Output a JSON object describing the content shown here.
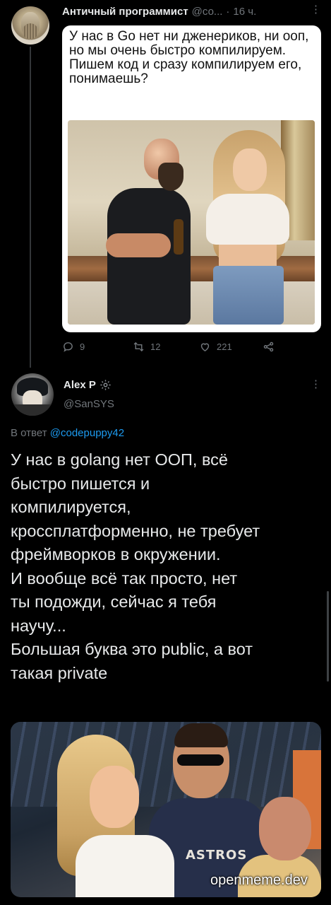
{
  "tweet1": {
    "author_name": "Античный программист",
    "handle_truncated": "@со...",
    "separator": "·",
    "time": "16 ч.",
    "more": "⋮",
    "quote_text": "У нас в Go нет ни дженериков, ни ооп, но мы очень быстро компилируем. Пишем код и сразу компилируем его, понимаешь?",
    "stats": {
      "replies": "9",
      "retweets": "12",
      "likes": "221"
    }
  },
  "tweet2": {
    "author_name": "Alex P",
    "handle": "@SanSYS",
    "more": "⋮",
    "reply_prefix": "В ответ",
    "reply_to": "@codepuppy42",
    "text": "У нас в golang нет ООП, всё\nбыстро пишется и\nкомпилируется,\nкроссплатформенно, не требует\nфреймворков в окружении.\nИ вообще всё так просто, нет\nты подожди, сейчас я тебя\nнаучу...\nБольшая буква это public, а вот\nтакая private",
    "image_caption": "ASTROS"
  },
  "watermark": "openmeme.dev",
  "colors": {
    "background": "#000000",
    "text": "#e7e9ea",
    "muted": "#71767b",
    "link": "#1d9bf0"
  },
  "icons": [
    "reply-icon",
    "retweet-icon",
    "like-icon",
    "share-icon",
    "gear-badge-icon",
    "more-icon"
  ]
}
